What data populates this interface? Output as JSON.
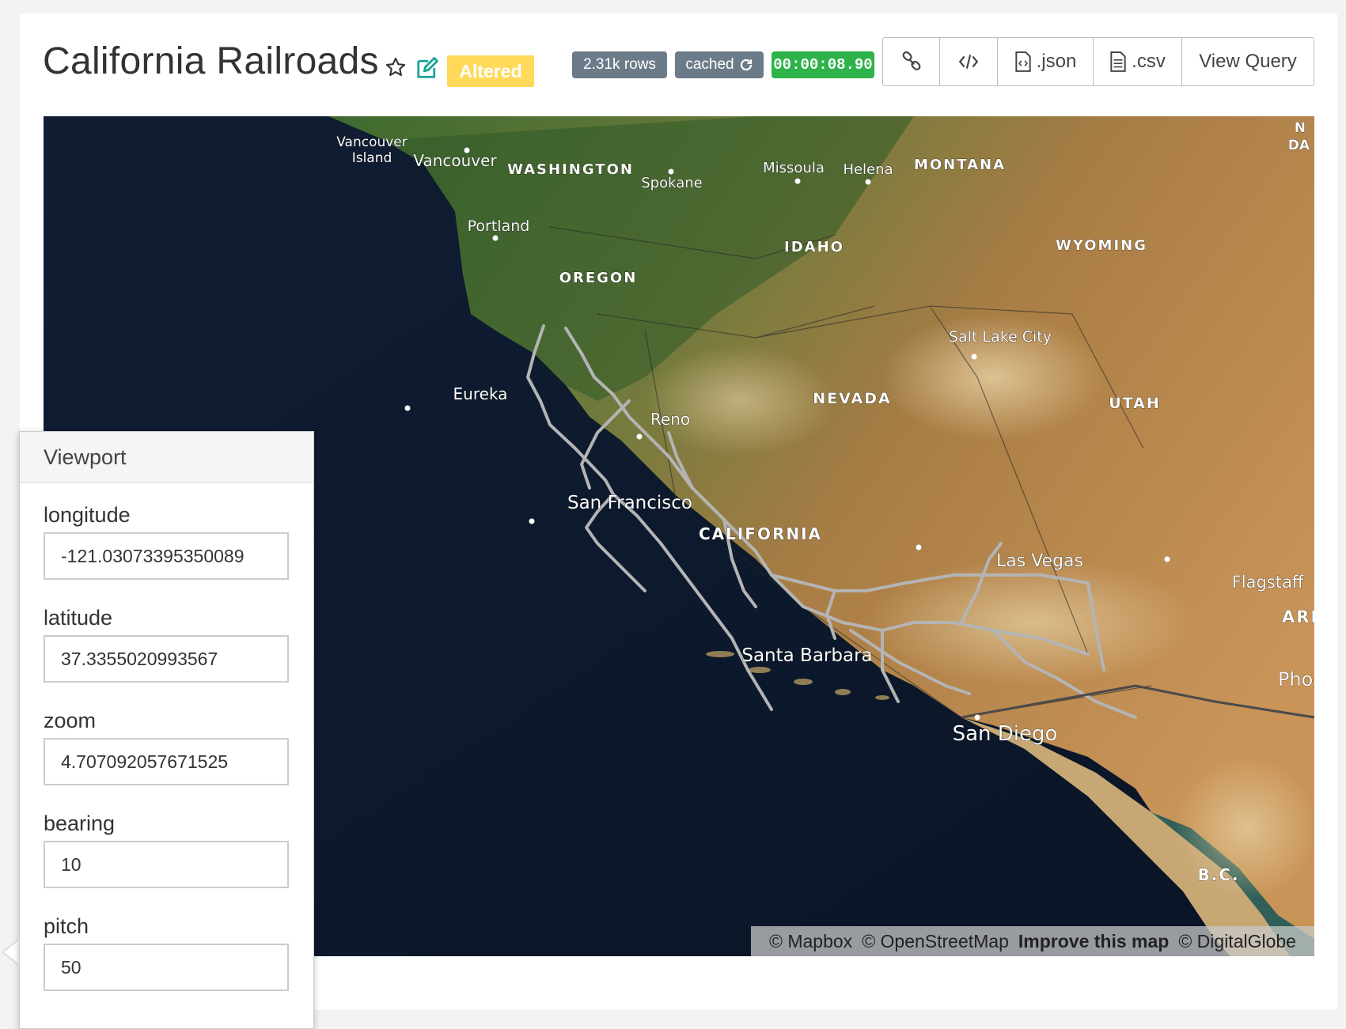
{
  "header": {
    "title": "California Railroads",
    "altered_label": "Altered",
    "rows_badge": "2.31k rows",
    "cached_badge": "cached",
    "timer": "00:00:08.90"
  },
  "toolbar": {
    "link_icon": "link-icon",
    "embed_icon": "code-icon",
    "json_label": ".json",
    "csv_label": ".csv",
    "view_query_label": "View Query"
  },
  "map": {
    "labels": {
      "vancouver_island_1": "Vancouver",
      "vancouver_island_2": "Island",
      "vancouver": "Vancouver",
      "washington": "WASHINGTON",
      "spokane": "Spokane",
      "missoula": "Missoula",
      "helena": "Helena",
      "montana": "MONTANA",
      "nd_1": "N",
      "nd_2": "DA",
      "portland": "Portland",
      "idaho": "IDAHO",
      "wyoming": "WYOMING",
      "oregon": "OREGON",
      "salt_lake_city": "Salt Lake City",
      "eureka": "Eureka",
      "reno": "Reno",
      "nevada": "NEVADA",
      "utah": "UTAH",
      "san_francisco": "San Francisco",
      "california": "CALIFORNIA",
      "las_vegas": "Las Vegas",
      "flagstaff": "Flagstaff",
      "ari": "ARI",
      "pho": "Pho",
      "santa_barbara": "Santa Barbara",
      "san_diego": "San Diego",
      "bc": "B.C."
    },
    "attribution": {
      "mapbox": "© Mapbox",
      "osm": "© OpenStreetMap",
      "improve": "Improve this map",
      "digitalglobe": "© DigitalGlobe"
    },
    "railroad_color": "#b4b4b4"
  },
  "viewport": {
    "title": "Viewport",
    "fields": [
      {
        "label": "longitude",
        "value": "-121.03073395350089"
      },
      {
        "label": "latitude",
        "value": "37.3355020993567"
      },
      {
        "label": "zoom",
        "value": "4.707092057671525"
      },
      {
        "label": "bearing",
        "value": "10"
      },
      {
        "label": "pitch",
        "value": "50"
      }
    ]
  },
  "colors": {
    "altered": "#ffd95a",
    "badge_gray": "#6b7b89",
    "timer_green": "#2db34a",
    "edit_teal": "#1aa39a"
  }
}
